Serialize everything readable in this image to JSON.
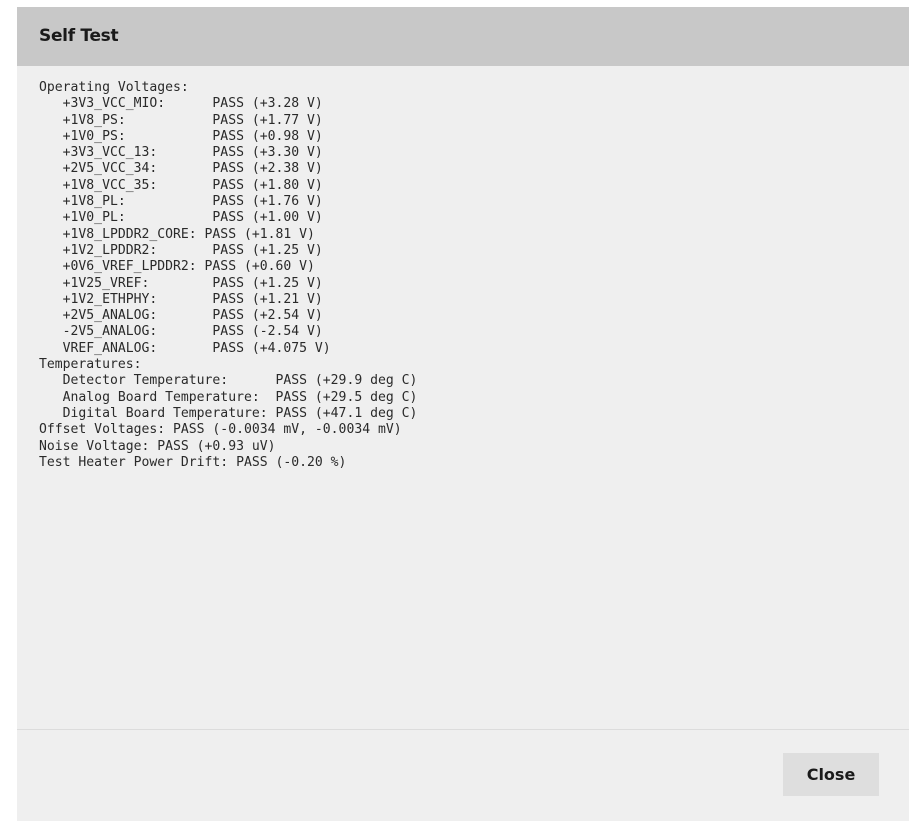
{
  "dialog": {
    "title": "Self Test",
    "close_label": "Close"
  },
  "report": {
    "text": "Operating Voltages:\n   +3V3_VCC_MIO:      PASS (+3.28 V)\n   +1V8_PS:           PASS (+1.77 V)\n   +1V0_PS:           PASS (+0.98 V)\n   +3V3_VCC_13:       PASS (+3.30 V)\n   +2V5_VCC_34:       PASS (+2.38 V)\n   +1V8_VCC_35:       PASS (+1.80 V)\n   +1V8_PL:           PASS (+1.76 V)\n   +1V0_PL:           PASS (+1.00 V)\n   +1V8_LPDDR2_CORE: PASS (+1.81 V)\n   +1V2_LPDDR2:       PASS (+1.25 V)\n   +0V6_VREF_LPDDR2: PASS (+0.60 V)\n   +1V25_VREF:        PASS (+1.25 V)\n   +1V2_ETHPHY:       PASS (+1.21 V)\n   +2V5_ANALOG:       PASS (+2.54 V)\n   -2V5_ANALOG:       PASS (-2.54 V)\n   VREF_ANALOG:       PASS (+4.075 V)\nTemperatures:\n   Detector Temperature:      PASS (+29.9 deg C)\n   Analog Board Temperature:  PASS (+29.5 deg C)\n   Digital Board Temperature: PASS (+47.1 deg C)\nOffset Voltages: PASS (-0.0034 mV, -0.0034 mV)\nNoise Voltage: PASS (+0.93 uV)\nTest Heater Power Drift: PASS (-0.20 %)"
  }
}
